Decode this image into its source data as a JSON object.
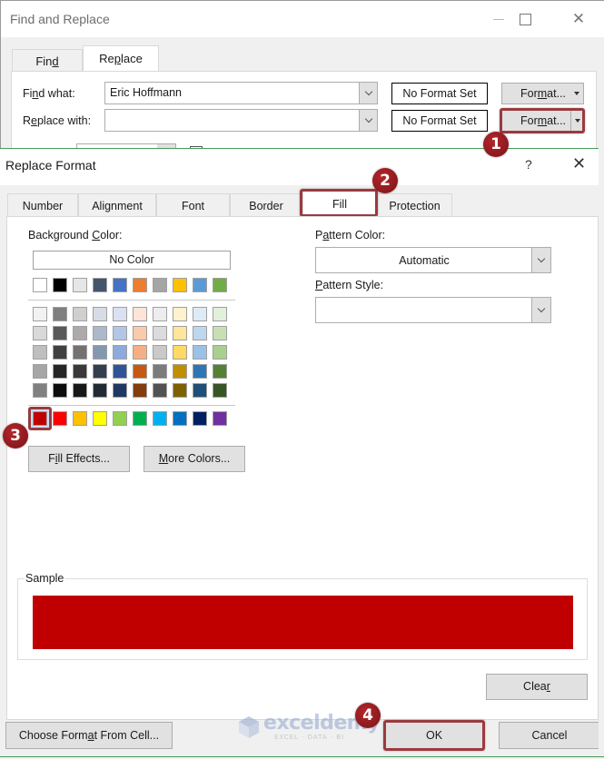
{
  "find_replace": {
    "title": "Find and Replace",
    "tabs": [
      {
        "label_pre": "Fin",
        "label_ul": "d",
        "label_post": "",
        "active": false
      },
      {
        "label_pre": "Re",
        "label_ul": "p",
        "label_post": "lace",
        "active": true
      }
    ],
    "find_what": {
      "label_pre": "Fi",
      "label_ul": "n",
      "label_post": "d what:",
      "value": "Eric Hoffmann",
      "format_preview": "No Format Set"
    },
    "replace_with": {
      "label_pre": "R",
      "label_ul": "e",
      "label_post": "place with:",
      "value": "",
      "format_preview": "No Format Set"
    },
    "format_button": {
      "label_pre": "For",
      "label_ul": "m",
      "label_post": "at..."
    },
    "icons": {
      "minimize": "minimize-icon",
      "maximize": "maximize-icon",
      "close": "close-icon"
    }
  },
  "replace_format": {
    "title": "Replace Format",
    "help": "?",
    "close": "✕",
    "tabs": [
      "Number",
      "Alignment",
      "Font",
      "Border",
      "Fill",
      "Protection"
    ],
    "active_tab": "Fill",
    "background_color": {
      "label_pre": "Background ",
      "label_ul": "C",
      "label_post": "olor:",
      "no_color": "No Color",
      "theme_row": [
        "#ffffff",
        "#000000",
        "#e7e6e6",
        "#44546a",
        "#4472c4",
        "#ed7d31",
        "#a5a5a5",
        "#ffc000",
        "#5b9bd5",
        "#70ad47"
      ],
      "tint_rows": [
        [
          "#f2f2f2",
          "#7f7f7f",
          "#d0cece",
          "#d6dce4",
          "#d9e1f2",
          "#fce4d6",
          "#ededed",
          "#fff2cc",
          "#ddebf7",
          "#e2efda"
        ],
        [
          "#d9d9d9",
          "#595959",
          "#aeaaaa",
          "#acb9ca",
          "#b4c6e7",
          "#f8cbad",
          "#dbdbdb",
          "#ffe699",
          "#bdd7ee",
          "#c6e0b4"
        ],
        [
          "#bfbfbf",
          "#404040",
          "#757171",
          "#8497b0",
          "#8ea9db",
          "#f4b084",
          "#c9c9c9",
          "#ffd966",
          "#9bc2e6",
          "#a9d08e"
        ],
        [
          "#a6a6a6",
          "#262626",
          "#3a3838",
          "#333f4f",
          "#2f5597",
          "#c65911",
          "#7b7b7b",
          "#bf8f00",
          "#2e75b6",
          "#548235"
        ],
        [
          "#808080",
          "#0d0d0d",
          "#171717",
          "#222b35",
          "#1f3864",
          "#833c0c",
          "#525252",
          "#7f6000",
          "#1f4e78",
          "#375623"
        ]
      ],
      "standard_row": [
        "#c00000",
        "#ff0000",
        "#ffc000",
        "#ffff00",
        "#92d050",
        "#00b050",
        "#00b0f0",
        "#0070c0",
        "#002060",
        "#7030a0"
      ],
      "selected": "#c00000",
      "fill_effects": {
        "pre": "F",
        "ul": "i",
        "post": "ll Effects..."
      },
      "more_colors": {
        "pre": "",
        "ul": "M",
        "post": "ore Colors..."
      }
    },
    "pattern_color": {
      "label_pre": "P",
      "label_ul": "a",
      "label_post": "ttern Color:",
      "value": "Automatic"
    },
    "pattern_style": {
      "label_pre": "",
      "label_ul": "P",
      "label_post": "attern Style:",
      "value": ""
    },
    "sample": {
      "label": "Sample",
      "color": "#c00000"
    },
    "clear": {
      "pre": "Clea",
      "ul": "r",
      "post": ""
    },
    "choose_format": {
      "pre": "Choose Form",
      "ul": "a",
      "post": "t From Cell..."
    },
    "ok": "OK",
    "cancel": "Cancel"
  },
  "annotations": {
    "steps": [
      "1",
      "2",
      "3",
      "4"
    ],
    "highlight_color": "#9b3a3e"
  },
  "watermark": {
    "name": "exceldemy",
    "tagline": "EXCEL · DATA · BI"
  }
}
